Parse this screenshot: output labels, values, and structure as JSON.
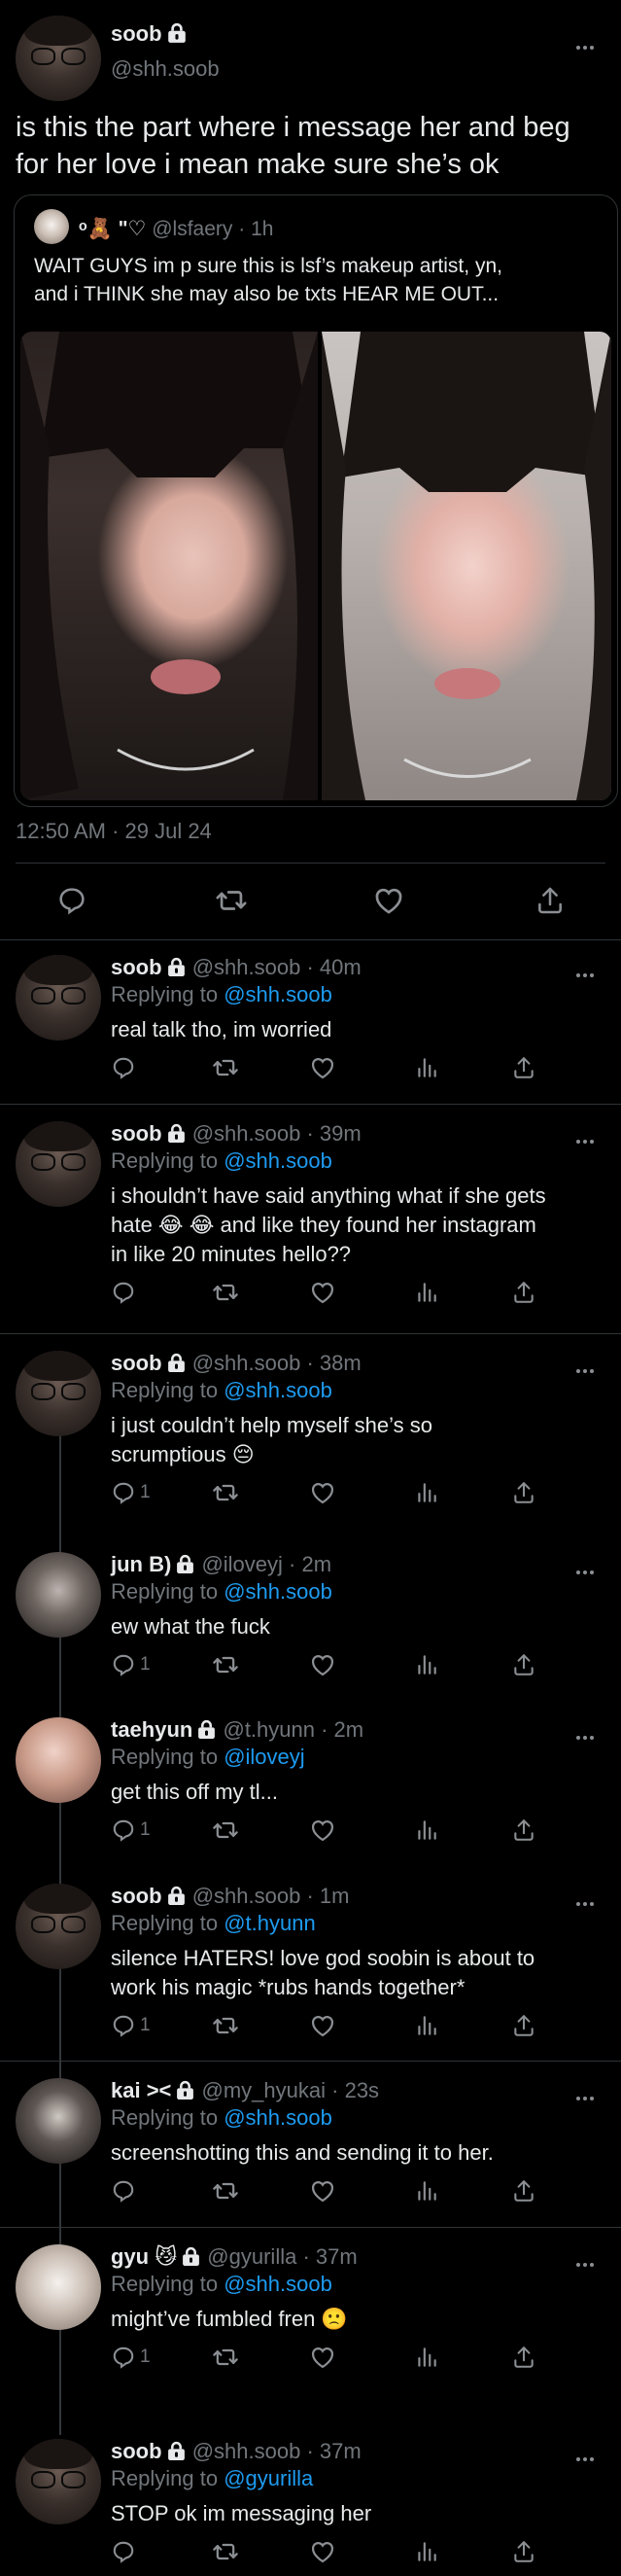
{
  "main_tweet": {
    "display_name": "soob",
    "handle": "@shh.soob",
    "text_line1": "is this the part where i message her and beg",
    "text_line2": "for her love i mean make sure she’s ok",
    "timestamp": "12:50 AM · 29 Jul 24"
  },
  "quoted_tweet": {
    "display_name": "ᵒ🧸 ʺ♡",
    "handle": "@lsfaery",
    "time": "· 1h",
    "text_line1": "WAIT GUYS im p sure this is lsf’s makeup artist, yn,",
    "text_line2": "and i THINK she may also be txts HEAR ME OUT..."
  },
  "replies": [
    {
      "display_name": "soob",
      "handle": "@shh.soob",
      "time": "· 40m",
      "replying_label": "Replying to",
      "replying_to": "@shh.soob",
      "lines": [
        "real talk tho, im worried"
      ],
      "reply_count": ""
    },
    {
      "display_name": "soob",
      "handle": "@shh.soob",
      "time": "· 39m",
      "replying_label": "Replying to",
      "replying_to": "@shh.soob",
      "lines": [
        "i shouldn’t have said anything what if she gets",
        "hate 😂 😂  and like they found her instagram",
        "in like 20 minutes hello??"
      ],
      "reply_count": ""
    },
    {
      "display_name": "soob",
      "handle": "@shh.soob",
      "time": "· 38m",
      "replying_label": "Replying to",
      "replying_to": "@shh.soob",
      "lines": [
        "i just couldn’t help myself she’s so",
        "scrumptious 😔"
      ],
      "reply_count": "1"
    },
    {
      "display_name": "jun B)",
      "handle": "@iloveyj",
      "time": "· 2m",
      "replying_label": "Replying to",
      "replying_to": "@shh.soob",
      "lines": [
        "ew what the fuck"
      ],
      "reply_count": "1"
    },
    {
      "display_name": "taehyun",
      "handle": "@t.hyunn",
      "time": "· 2m",
      "replying_label": "Replying to",
      "replying_to": "@iloveyj",
      "lines": [
        "get this off my tl..."
      ],
      "reply_count": "1"
    },
    {
      "display_name": "soob",
      "handle": "@shh.soob",
      "time": "· 1m",
      "replying_label": "Replying to",
      "replying_to": "@t.hyunn",
      "lines": [
        "silence HATERS! love god soobin is about to",
        "work his magic *rubs hands together*"
      ],
      "reply_count": "1"
    },
    {
      "display_name": "kai ><",
      "handle": "@my_hyukai",
      "time": "· 23s",
      "replying_label": "Replying to",
      "replying_to": "@shh.soob",
      "lines": [
        "screenshotting this and sending it to her."
      ],
      "reply_count": ""
    },
    {
      "display_name": "gyu 😼",
      "handle": "@gyurilla",
      "time": "· 37m",
      "replying_label": "Replying to",
      "replying_to": "@shh.soob",
      "lines": [
        "might’ve fumbled fren 🙁"
      ],
      "reply_count": "1"
    },
    {
      "display_name": "soob",
      "handle": "@shh.soob",
      "time": "· 37m",
      "replying_label": "Replying to",
      "replying_to": "@gyurilla",
      "lines": [
        "STOP ok im messaging her"
      ],
      "reply_count": ""
    }
  ],
  "icons": {
    "reply": "reply-icon",
    "retweet": "retweet-icon",
    "like": "heart-icon",
    "views": "views-icon",
    "share": "share-icon",
    "lock": "lock-icon",
    "more": "more-icon"
  },
  "colors": {
    "background": "#000000",
    "text": "#e7e9ea",
    "muted": "#71767b",
    "link": "#1d9bf0",
    "divider": "#2f3336"
  }
}
